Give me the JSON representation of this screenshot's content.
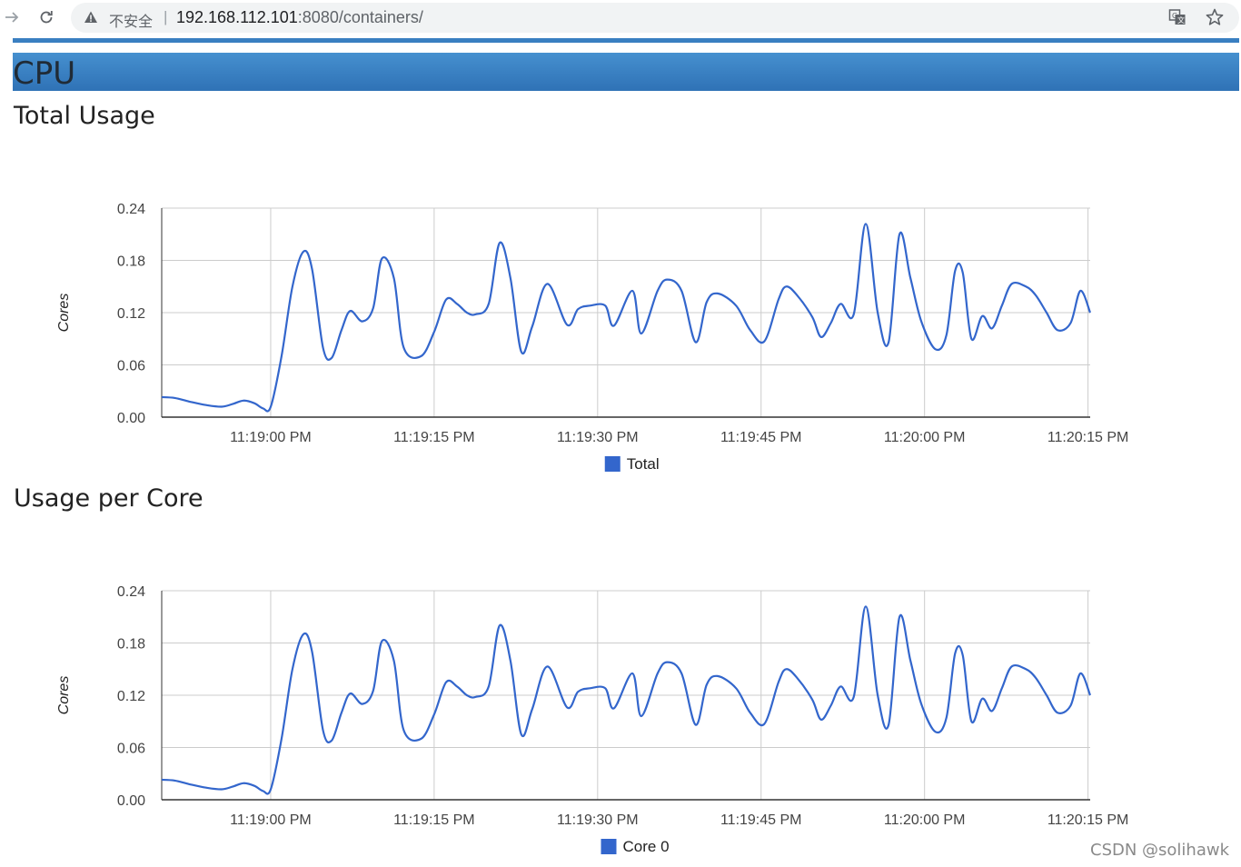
{
  "browser": {
    "insecure_label": "不安全",
    "separator": "|",
    "url_host": "192.168.112.101",
    "url_path": ":8080/containers/"
  },
  "page": {
    "section_title": "CPU",
    "watermark": "CSDN @solihawk"
  },
  "colors": {
    "line": "#3366cc",
    "header_bar": "#3a7fc1",
    "grid": "#cccccc"
  },
  "charts": [
    {
      "heading": "Total Usage"
    },
    {
      "heading": "Usage per Core"
    }
  ],
  "chart_data": [
    {
      "type": "line",
      "title": "Total Usage",
      "ylabel": "Cores",
      "xlabel": "",
      "ylim": [
        0,
        0.24
      ],
      "yticks": [
        "0.00",
        "0.06",
        "0.12",
        "0.18",
        "0.24"
      ],
      "xticks": [
        "11:19:00 PM",
        "11:19:15 PM",
        "11:19:30 PM",
        "11:19:45 PM",
        "11:20:00 PM",
        "11:20:15 PM"
      ],
      "xtick_seconds": [
        10,
        25,
        40,
        55,
        70,
        85
      ],
      "xlim_seconds": [
        0,
        85.2
      ],
      "legend": "bottom-center",
      "grid": true,
      "series": [
        {
          "name": "Total",
          "color": "#3366cc",
          "t": [
            0,
            1.2,
            2.5,
            4.0,
            5.5,
            6.5,
            7.5,
            8.5,
            9.3,
            10.0,
            11.0,
            12.0,
            13.0,
            13.8,
            14.8,
            15.6,
            16.5,
            17.3,
            18.4,
            19.4,
            20.2,
            21.3,
            22.2,
            23.8,
            25.0,
            26.1,
            27.1,
            28.0,
            28.8,
            30.0,
            31.0,
            32.0,
            33.0,
            34.0,
            35.4,
            37.2,
            38.2,
            39.3,
            40.7,
            41.5,
            43.2,
            44.0,
            45.5,
            46.4,
            47.7,
            49.0,
            50.0,
            51.0,
            52.7,
            54.0,
            55.3,
            56.6,
            57.3,
            58.3,
            59.7,
            60.5,
            61.4,
            62.3,
            63.5,
            64.6,
            65.7,
            66.7,
            67.7,
            68.7,
            69.7,
            71.0,
            72.0,
            72.8,
            73.5,
            74.3,
            75.3,
            76.2,
            77.1,
            78.0,
            79.3,
            80.2,
            81.2,
            82.2,
            83.4,
            84.3,
            85.2
          ],
          "values": [
            0.023,
            0.022,
            0.018,
            0.014,
            0.012,
            0.015,
            0.019,
            0.016,
            0.01,
            0.012,
            0.07,
            0.15,
            0.19,
            0.17,
            0.08,
            0.068,
            0.1,
            0.122,
            0.11,
            0.125,
            0.182,
            0.16,
            0.08,
            0.07,
            0.098,
            0.135,
            0.13,
            0.12,
            0.118,
            0.13,
            0.2,
            0.16,
            0.075,
            0.104,
            0.153,
            0.106,
            0.124,
            0.128,
            0.128,
            0.105,
            0.145,
            0.096,
            0.145,
            0.158,
            0.145,
            0.086,
            0.132,
            0.142,
            0.128,
            0.1,
            0.087,
            0.135,
            0.15,
            0.14,
            0.115,
            0.092,
            0.108,
            0.13,
            0.118,
            0.222,
            0.12,
            0.086,
            0.21,
            0.16,
            0.11,
            0.078,
            0.094,
            0.168,
            0.166,
            0.09,
            0.116,
            0.102,
            0.128,
            0.153,
            0.15,
            0.14,
            0.12,
            0.1,
            0.108,
            0.145,
            0.12
          ]
        }
      ]
    },
    {
      "type": "line",
      "title": "Usage per Core",
      "ylabel": "Cores",
      "xlabel": "",
      "ylim": [
        0,
        0.24
      ],
      "yticks": [
        "0.00",
        "0.06",
        "0.12",
        "0.18",
        "0.24"
      ],
      "xticks": [
        "11:19:00 PM",
        "11:19:15 PM",
        "11:19:30 PM",
        "11:19:45 PM",
        "11:20:00 PM",
        "11:20:15 PM"
      ],
      "xtick_seconds": [
        10,
        25,
        40,
        55,
        70,
        85
      ],
      "xlim_seconds": [
        0,
        85.2
      ],
      "legend": "bottom-center",
      "grid": true,
      "series": [
        {
          "name": "Core 0",
          "color": "#3366cc",
          "t": [
            0,
            1.2,
            2.5,
            4.0,
            5.5,
            6.5,
            7.5,
            8.5,
            9.3,
            10.0,
            11.0,
            12.0,
            13.0,
            13.8,
            14.8,
            15.6,
            16.5,
            17.3,
            18.4,
            19.4,
            20.2,
            21.3,
            22.2,
            23.8,
            25.0,
            26.1,
            27.1,
            28.0,
            28.8,
            30.0,
            31.0,
            32.0,
            33.0,
            34.0,
            35.4,
            37.2,
            38.2,
            39.3,
            40.7,
            41.5,
            43.2,
            44.0,
            45.5,
            46.4,
            47.7,
            49.0,
            50.0,
            51.0,
            52.7,
            54.0,
            55.3,
            56.6,
            57.3,
            58.3,
            59.7,
            60.5,
            61.4,
            62.3,
            63.5,
            64.6,
            65.7,
            66.7,
            67.7,
            68.7,
            69.7,
            71.0,
            72.0,
            72.8,
            73.5,
            74.3,
            75.3,
            76.2,
            77.1,
            78.0,
            79.3,
            80.2,
            81.2,
            82.2,
            83.4,
            84.3,
            85.2
          ],
          "values": [
            0.023,
            0.022,
            0.018,
            0.014,
            0.012,
            0.015,
            0.019,
            0.016,
            0.01,
            0.012,
            0.07,
            0.15,
            0.19,
            0.17,
            0.08,
            0.068,
            0.1,
            0.122,
            0.11,
            0.125,
            0.182,
            0.16,
            0.08,
            0.07,
            0.098,
            0.135,
            0.13,
            0.12,
            0.118,
            0.13,
            0.2,
            0.16,
            0.075,
            0.104,
            0.153,
            0.106,
            0.124,
            0.128,
            0.128,
            0.105,
            0.145,
            0.096,
            0.145,
            0.158,
            0.145,
            0.086,
            0.132,
            0.142,
            0.128,
            0.1,
            0.087,
            0.135,
            0.15,
            0.14,
            0.115,
            0.092,
            0.108,
            0.13,
            0.118,
            0.222,
            0.12,
            0.086,
            0.21,
            0.16,
            0.11,
            0.078,
            0.094,
            0.168,
            0.166,
            0.09,
            0.116,
            0.102,
            0.128,
            0.153,
            0.15,
            0.14,
            0.12,
            0.1,
            0.108,
            0.145,
            0.12
          ]
        }
      ]
    }
  ]
}
